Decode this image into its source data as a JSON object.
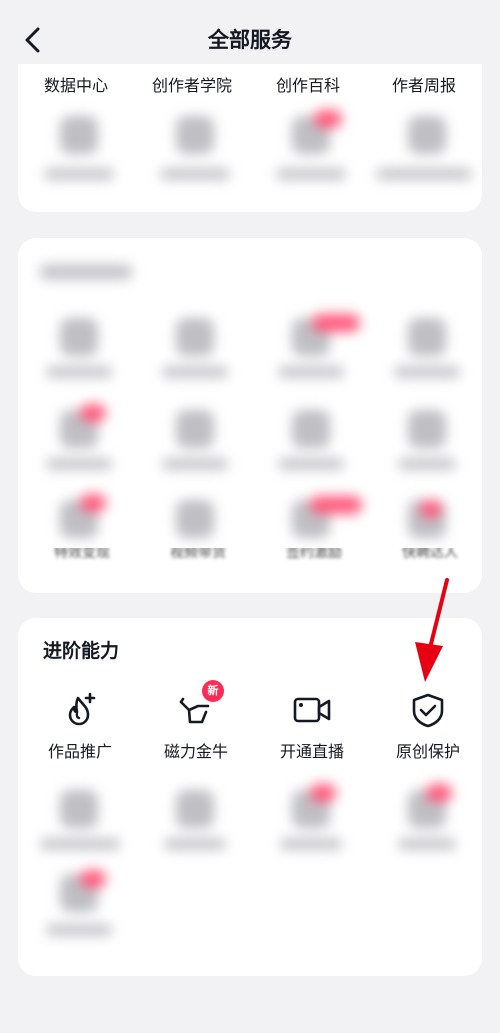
{
  "header": {
    "title": "全部服务",
    "back_icon": "chevron-left-icon"
  },
  "top_row": {
    "labels": [
      "数据中心",
      "创作者学院",
      "创作百科",
      "作者周报"
    ]
  },
  "advanced": {
    "title": "进阶能力",
    "items": [
      {
        "label": "作品推广",
        "icon": "flame-plus-icon"
      },
      {
        "label": "磁力金牛",
        "icon": "bull-icon",
        "badge": "新"
      },
      {
        "label": "开通直播",
        "icon": "video-camera-icon"
      },
      {
        "label": "原创保护",
        "icon": "shield-check-icon"
      }
    ]
  },
  "colors": {
    "accent": "#fe2c55",
    "arrow": "#e60012"
  }
}
